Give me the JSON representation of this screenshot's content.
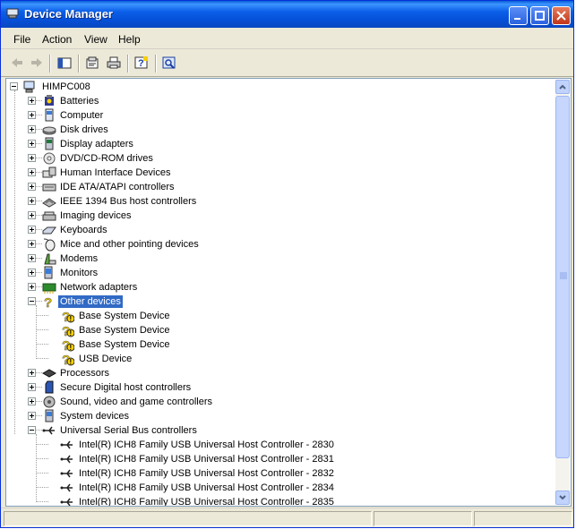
{
  "window": {
    "title": "Device Manager",
    "accent": "#0a5fd8",
    "selection_color": "#316ac5"
  },
  "menu": [
    "File",
    "Action",
    "View",
    "Help"
  ],
  "toolbar_icons": [
    "back-arrow-icon",
    "forward-arrow-icon",
    "console-tree-icon",
    "properties-icon",
    "print-icon",
    "help-icon",
    "scan-hardware-icon"
  ],
  "tree": {
    "root": "HIMPC008",
    "items": [
      {
        "label": "Batteries",
        "icon": "battery-icon",
        "expanded": false
      },
      {
        "label": "Computer",
        "icon": "computer-icon",
        "expanded": false
      },
      {
        "label": "Disk drives",
        "icon": "disk-drive-icon",
        "expanded": false
      },
      {
        "label": "Display adapters",
        "icon": "display-adapter-icon",
        "expanded": false
      },
      {
        "label": "DVD/CD-ROM drives",
        "icon": "dvd-drive-icon",
        "expanded": false
      },
      {
        "label": "Human Interface Devices",
        "icon": "hid-icon",
        "expanded": false
      },
      {
        "label": "IDE ATA/ATAPI controllers",
        "icon": "ide-controller-icon",
        "expanded": false
      },
      {
        "label": "IEEE 1394 Bus host controllers",
        "icon": "firewire-icon",
        "expanded": false
      },
      {
        "label": "Imaging devices",
        "icon": "imaging-icon",
        "expanded": false
      },
      {
        "label": "Keyboards",
        "icon": "keyboard-icon",
        "expanded": false
      },
      {
        "label": "Mice and other pointing devices",
        "icon": "mouse-icon",
        "expanded": false
      },
      {
        "label": "Modems",
        "icon": "modem-icon",
        "expanded": false
      },
      {
        "label": "Monitors",
        "icon": "monitor-icon",
        "expanded": false
      },
      {
        "label": "Network adapters",
        "icon": "network-adapter-icon",
        "expanded": false
      },
      {
        "label": "Other devices",
        "icon": "question-icon",
        "expanded": true,
        "selected": true,
        "children": [
          "Base System Device",
          "Base System Device",
          "Base System Device",
          "USB Device"
        ]
      },
      {
        "label": "Processors",
        "icon": "processor-icon",
        "expanded": false
      },
      {
        "label": "Secure Digital host controllers",
        "icon": "sd-controller-icon",
        "expanded": false
      },
      {
        "label": "Sound, video and game controllers",
        "icon": "sound-icon",
        "expanded": false
      },
      {
        "label": "System devices",
        "icon": "system-device-icon",
        "expanded": false
      },
      {
        "label": "Universal Serial Bus controllers",
        "icon": "usb-icon",
        "expanded": true,
        "children": [
          "Intel(R) ICH8 Family USB Universal Host Controller - 2830",
          "Intel(R) ICH8 Family USB Universal Host Controller - 2831",
          "Intel(R) ICH8 Family USB Universal Host Controller - 2832",
          "Intel(R) ICH8 Family USB Universal Host Controller - 2834",
          "Intel(R) ICH8 Family USB Universal Host Controller - 2835"
        ]
      }
    ]
  }
}
